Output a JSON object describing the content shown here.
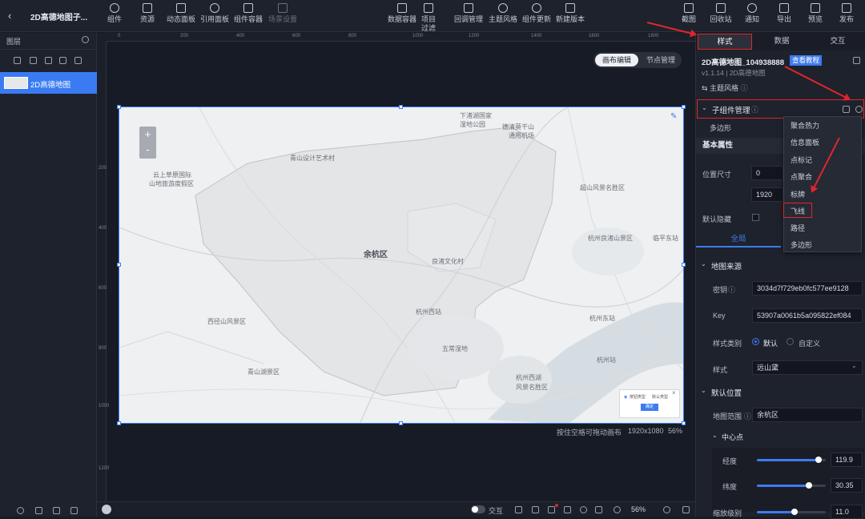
{
  "header": {
    "back_icon": "chevron-left-icon",
    "title": "2D高德地图子...",
    "left_tools": [
      {
        "label": "组件",
        "icon": "component-icon"
      },
      {
        "label": "资源",
        "icon": "layers-icon"
      },
      {
        "label": "动态面板",
        "icon": "grid-icon"
      },
      {
        "label": "引用面板",
        "icon": "link-icon"
      },
      {
        "label": "组件容器",
        "icon": "container-icon"
      },
      {
        "label": "场景设置",
        "icon": "scene-icon"
      }
    ],
    "center_tools": [
      {
        "label": "数据容器",
        "icon": "database-icon"
      },
      {
        "label": "项目过滤器",
        "icon": "filter-icon"
      },
      {
        "label": "回调管理",
        "icon": "callback-icon"
      },
      {
        "label": "主题风格",
        "icon": "theme-icon"
      },
      {
        "label": "组件更新",
        "icon": "refresh-icon"
      },
      {
        "label": "新建版本",
        "icon": "new-version-icon"
      }
    ],
    "right_tools": [
      {
        "label": "截图",
        "icon": "screenshot-icon"
      },
      {
        "label": "回收站",
        "icon": "trash-icon"
      },
      {
        "label": "通知",
        "icon": "bell-icon"
      },
      {
        "label": "导出",
        "icon": "export-icon"
      },
      {
        "label": "预览",
        "icon": "preview-icon"
      },
      {
        "label": "发布",
        "icon": "send-icon"
      }
    ]
  },
  "layers": {
    "title": "图层",
    "search_icon": "search-icon",
    "items": [
      {
        "label": "2D高德地图"
      }
    ]
  },
  "canvas": {
    "tabs": [
      "画布编辑",
      "节点管理"
    ],
    "active_tab": "画布编辑",
    "ruler_h": [
      "0",
      "200",
      "400",
      "600",
      "800",
      "1000",
      "1200",
      "1400",
      "1600",
      "1800"
    ],
    "ruler_v": [
      "200",
      "400",
      "600",
      "800",
      "1000",
      "1200"
    ],
    "hint": "按住空格可拖动画布",
    "size": "1920x1080",
    "zoom_text": "56%",
    "map_labels": [
      "下渚湖国家",
      "湿地公园",
      "德清莫干山",
      "通用机场",
      "青山设计艺术村",
      "云上草原国际",
      "山地旅游度假区",
      "超山风景名胜区",
      "余杭区",
      "良渚文化村",
      "杭州良渚山景区",
      "临平东站",
      "西径山风景区",
      "杭州西站",
      "杭州东站",
      "五常湿地",
      "青山湖景区",
      "杭州西湖",
      "风景名胜区",
      "杭州站"
    ],
    "mini_panel": {
      "option1": "按钮类型",
      "option2": "默认类型",
      "button": "确定"
    },
    "zoom_in": "+",
    "zoom_out": "-"
  },
  "bottombar": {
    "interactive_label": "交互",
    "zoom": "56%"
  },
  "right_panel": {
    "tabs": [
      "样式",
      "数据",
      "交互"
    ],
    "active_tab": "样式",
    "component_name": "2D高德地图_104938888",
    "tutorial_link": "查看教程",
    "version": "v1.1.14 | 2D高德地图",
    "theme_label": "主题风格",
    "subcomp_title": "子组件管理",
    "subcomp_current": "多边形",
    "basic_title": "基本属性",
    "pos_label": "位置尺寸",
    "pos_x": "0",
    "width": "1920",
    "hide_label": "默认隐藏",
    "global_tab": "全局",
    "source_title": "地图来源",
    "key_secret_label": "密钥",
    "key_secret": "3034d7f729eb0fc577ee9128",
    "key_label": "Key",
    "key_value": "53907a0061b5a095822ef084",
    "style_type_label": "样式类别",
    "style_default": "默认",
    "style_custom": "自定义",
    "style_label": "样式",
    "style_value": "远山黛",
    "default_pos_title": "默认位置",
    "map_range_label": "地图范围",
    "map_range_value": "余杭区",
    "center_label": "中心点",
    "lng_label": "经度",
    "lng_value": "119.9",
    "lng_level": 0.9,
    "lat_label": "纬度",
    "lat_value": "30.35",
    "lat_level": 0.75,
    "zoom_label": "缩放级别",
    "zoom_value": "11.0",
    "zoom_level": 0.55
  },
  "dropdown": {
    "items": [
      "聚合热力",
      "信息面板",
      "点标记",
      "点聚合",
      "标牌",
      "飞线",
      "路径",
      "多边形"
    ],
    "highlighted": "飞线"
  },
  "colors": {
    "accent": "#3d7bf0",
    "highlight": "#e0262b"
  }
}
